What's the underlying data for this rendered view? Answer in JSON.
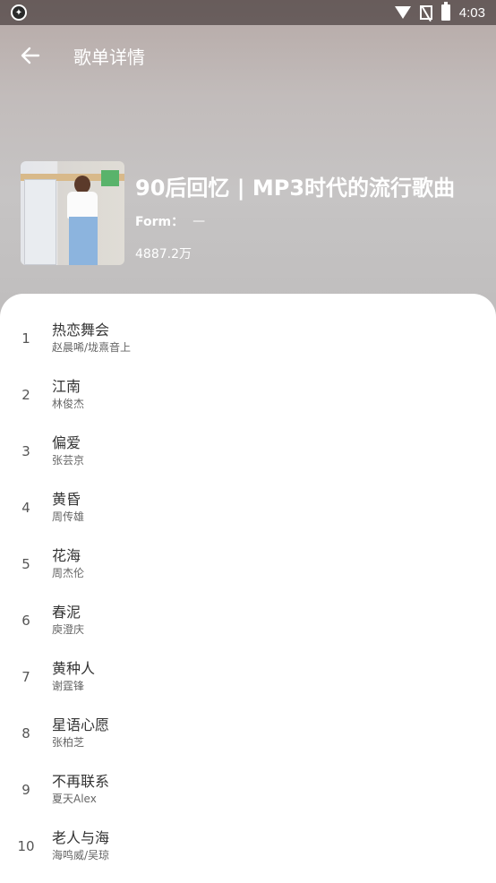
{
  "status_bar": {
    "time": "4:03",
    "icons": [
      "app-icon",
      "wifi-icon",
      "signal-icon",
      "battery-icon"
    ]
  },
  "header": {
    "title": "歌单详情",
    "back_icon": "arrow-left-icon"
  },
  "playlist": {
    "title": "90后回忆 | MP3时代的流行歌曲",
    "form_label": "Form：",
    "form_value": "—",
    "play_count": "4887.2万"
  },
  "songs": [
    {
      "index": "1",
      "title": "热恋舞会",
      "artist": "赵晨唏/垅熹音上"
    },
    {
      "index": "2",
      "title": "江南",
      "artist": "林俊杰"
    },
    {
      "index": "3",
      "title": "偏爱",
      "artist": "张芸京"
    },
    {
      "index": "4",
      "title": "黄昏",
      "artist": "周传雄"
    },
    {
      "index": "5",
      "title": "花海",
      "artist": "周杰伦"
    },
    {
      "index": "6",
      "title": "春泥",
      "artist": "庾澄庆"
    },
    {
      "index": "7",
      "title": "黄种人",
      "artist": "谢霆锋"
    },
    {
      "index": "8",
      "title": "星语心愿",
      "artist": "张柏芝"
    },
    {
      "index": "9",
      "title": "不再联系",
      "artist": "夏天Alex"
    },
    {
      "index": "10",
      "title": "老人与海",
      "artist": "海鸣威/吴琼"
    }
  ],
  "colors": {
    "header_text": "#ffffff",
    "song_title": "#333333",
    "song_artist": "#666666"
  }
}
